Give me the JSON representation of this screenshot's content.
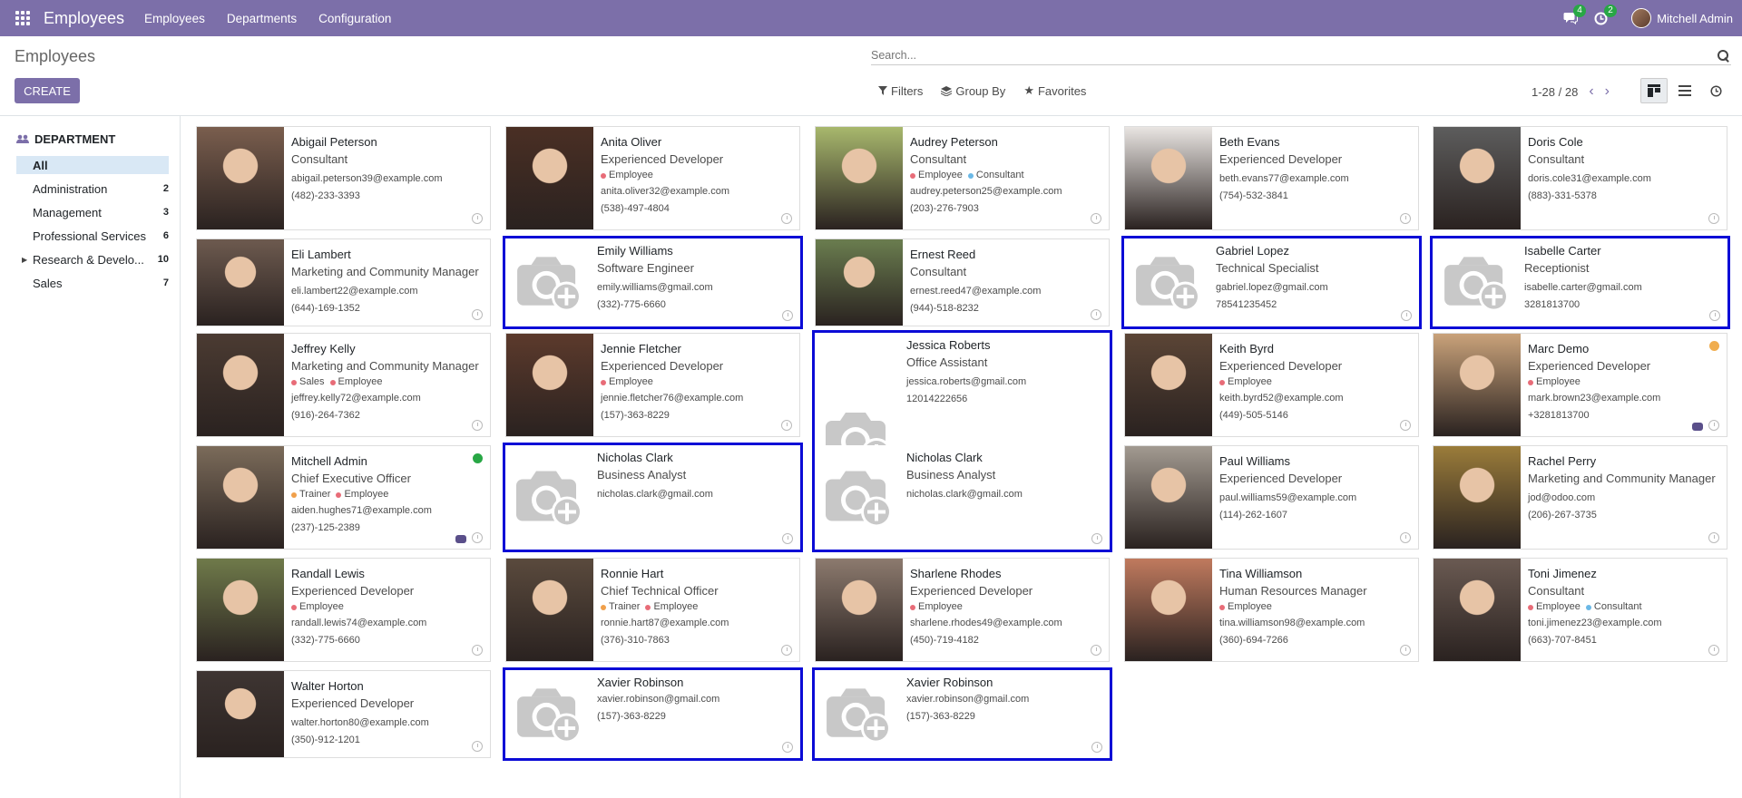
{
  "topbar": {
    "app_name": "Employees",
    "menu": [
      "Employees",
      "Departments",
      "Configuration"
    ],
    "messages_count": "4",
    "activities_count": "2",
    "user_name": "Mitchell Admin"
  },
  "control": {
    "breadcrumb": "Employees",
    "create_label": "CREATE",
    "search_placeholder": "Search...",
    "filters_label": "Filters",
    "groupby_label": "Group By",
    "favorites_label": "Favorites",
    "pager": "1-28 / 28"
  },
  "sidebar": {
    "header": "DEPARTMENT",
    "items": [
      {
        "label": "All",
        "count": ""
      },
      {
        "label": "Administration",
        "count": "2"
      },
      {
        "label": "Management",
        "count": "3"
      },
      {
        "label": "Professional Services",
        "count": "6"
      },
      {
        "label": "Research & Develo...",
        "count": "10"
      },
      {
        "label": "Sales",
        "count": "7"
      }
    ]
  },
  "tag_colors": {
    "Employee": "#e86c78",
    "Consultant": "#6ab8e6",
    "Sales": "#e86c78",
    "Trainer": "#f0a04b"
  },
  "employees": [
    {
      "name": "Abigail Peterson",
      "job": "Consultant",
      "tags": [],
      "email": "abigail.peterson39@example.com",
      "phone": "(482)-233-3393",
      "photo": true,
      "bg": "#7a5e4e"
    },
    {
      "name": "Anita Oliver",
      "job": "Experienced Developer",
      "tags": [
        "Employee"
      ],
      "email": "anita.oliver32@example.com",
      "phone": "(538)-497-4804",
      "photo": true,
      "bg": "#4a2f24"
    },
    {
      "name": "Audrey Peterson",
      "job": "Consultant",
      "tags": [
        "Employee",
        "Consultant"
      ],
      "email": "audrey.peterson25@example.com",
      "phone": "(203)-276-7903",
      "photo": true,
      "bg": "#a8b86d"
    },
    {
      "name": "Beth Evans",
      "job": "Experienced Developer",
      "tags": [],
      "email": "beth.evans77@example.com",
      "phone": "(754)-532-3841",
      "photo": true,
      "bg": "#e9e5e2"
    },
    {
      "name": "Doris Cole",
      "job": "Consultant",
      "tags": [],
      "email": "doris.cole31@example.com",
      "phone": "(883)-331-5378",
      "photo": true,
      "bg": "#5d5d5d"
    },
    {
      "name": "Eli Lambert",
      "job": "Marketing and Community Manager",
      "tags": [],
      "email": "eli.lambert22@example.com",
      "phone": "(644)-169-1352",
      "photo": true,
      "bg": "#6d5a4f"
    },
    {
      "name": "Emily Williams",
      "job": "Software Engineer",
      "tags": [],
      "email": "emily.williams@gmail.com",
      "phone": "(332)-775-6660",
      "photo": false,
      "hl": true
    },
    {
      "name": "Ernest Reed",
      "job": "Consultant",
      "tags": [],
      "email": "ernest.reed47@example.com",
      "phone": "(944)-518-8232",
      "photo": true,
      "bg": "#6a7d4f"
    },
    {
      "name": "Gabriel Lopez",
      "job": "Technical Specialist",
      "tags": [],
      "email": "gabriel.lopez@gmail.com",
      "phone": "78541235452",
      "photo": false,
      "hl": true
    },
    {
      "name": "Isabelle Carter",
      "job": "Receptionist",
      "tags": [],
      "email": "isabelle.carter@gmail.com",
      "phone": "3281813700",
      "photo": false,
      "hl": true
    },
    {
      "name": "Jeffrey Kelly",
      "job": "Marketing and Community Manager",
      "tags": [
        "Sales",
        "Employee"
      ],
      "email": "jeffrey.kelly72@example.com",
      "phone": "(916)-264-7362",
      "photo": true,
      "bg": "#4b3b32"
    },
    {
      "name": "Jennie Fletcher",
      "job": "Experienced Developer",
      "tags": [
        "Employee"
      ],
      "email": "jennie.fletcher76@example.com",
      "phone": "(157)-363-8229",
      "photo": true,
      "bg": "#5c3a2c"
    },
    {
      "name": "Jessica Roberts",
      "job": "Office Assistant",
      "tags": [],
      "email": "jessica.roberts@gmail.com",
      "phone": "12014222656",
      "photo": false,
      "hl": true
    },
    {
      "name": "Keith Byrd",
      "job": "Experienced Developer",
      "tags": [
        "Employee"
      ],
      "email": "keith.byrd52@example.com",
      "phone": "(449)-505-5146",
      "photo": true,
      "bg": "#5b4536"
    },
    {
      "name": "Marc Demo",
      "job": "Experienced Developer",
      "tags": [
        "Employee"
      ],
      "email": "mark.brown23@example.com",
      "phone": "+3281813700",
      "photo": true,
      "bg": "#c9a27a",
      "status": "#f0ad4e",
      "chat": true
    },
    {
      "name": "Mitchell Admin",
      "job": "Chief Executive Officer",
      "tags": [
        "Trainer",
        "Employee"
      ],
      "email": "aiden.hughes71@example.com",
      "phone": "(237)-125-2389",
      "photo": true,
      "bg": "#7b6b5a",
      "status": "#28a745",
      "chat": true
    },
    {
      "name": "Nicholas Clark",
      "job": "Business Analyst",
      "tags": [],
      "email": "nicholas.clark@gmail.com",
      "phone": "",
      "photo": false,
      "hl": true
    },
    {
      "name": "Nicholas Clark",
      "job": "Business Analyst",
      "tags": [],
      "email": "nicholas.clark@gmail.com",
      "phone": "",
      "photo": false,
      "hl": true
    },
    {
      "name": "Paul Williams",
      "job": "Experienced Developer",
      "tags": [],
      "email": "paul.williams59@example.com",
      "phone": "(114)-262-1607",
      "photo": true,
      "bg": "#a29a91"
    },
    {
      "name": "Rachel Perry",
      "job": "Marketing and Community Manager",
      "tags": [],
      "email": "jod@odoo.com",
      "phone": "(206)-267-3735",
      "photo": true,
      "bg": "#9b7c3a"
    },
    {
      "name": "Randall Lewis",
      "job": "Experienced Developer",
      "tags": [
        "Employee"
      ],
      "email": "randall.lewis74@example.com",
      "phone": "(332)-775-6660",
      "photo": true,
      "bg": "#6f7a4a"
    },
    {
      "name": "Ronnie Hart",
      "job": "Chief Technical Officer",
      "tags": [
        "Trainer",
        "Employee"
      ],
      "email": "ronnie.hart87@example.com",
      "phone": "(376)-310-7863",
      "photo": true,
      "bg": "#5a4a3d"
    },
    {
      "name": "Sharlene Rhodes",
      "job": "Experienced Developer",
      "tags": [
        "Employee"
      ],
      "email": "sharlene.rhodes49@example.com",
      "phone": "(450)-719-4182",
      "photo": true,
      "bg": "#8c7a6e"
    },
    {
      "name": "Tina Williamson",
      "job": "Human Resources Manager",
      "tags": [
        "Employee"
      ],
      "email": "tina.williamson98@example.com",
      "phone": "(360)-694-7266",
      "photo": true,
      "bg": "#c07a5e"
    },
    {
      "name": "Toni Jimenez",
      "job": "Consultant",
      "tags": [
        "Employee",
        "Consultant"
      ],
      "email": "toni.jimenez23@example.com",
      "phone": "(663)-707-8451",
      "photo": true,
      "bg": "#6a5a52"
    },
    {
      "name": "Walter Horton",
      "job": "Experienced Developer",
      "tags": [],
      "email": "walter.horton80@example.com",
      "phone": "(350)-912-1201",
      "photo": true,
      "bg": "#3e3532"
    },
    {
      "name": "Xavier Robinson",
      "job": "",
      "tags": [],
      "email": "xavier.robinson@gmail.com",
      "phone": "(157)-363-8229",
      "photo": false,
      "hl": true
    },
    {
      "name": "Xavier Robinson",
      "job": "",
      "tags": [],
      "email": "xavier.robinson@gmail.com",
      "phone": "(157)-363-8229",
      "photo": false,
      "hl": true
    }
  ]
}
